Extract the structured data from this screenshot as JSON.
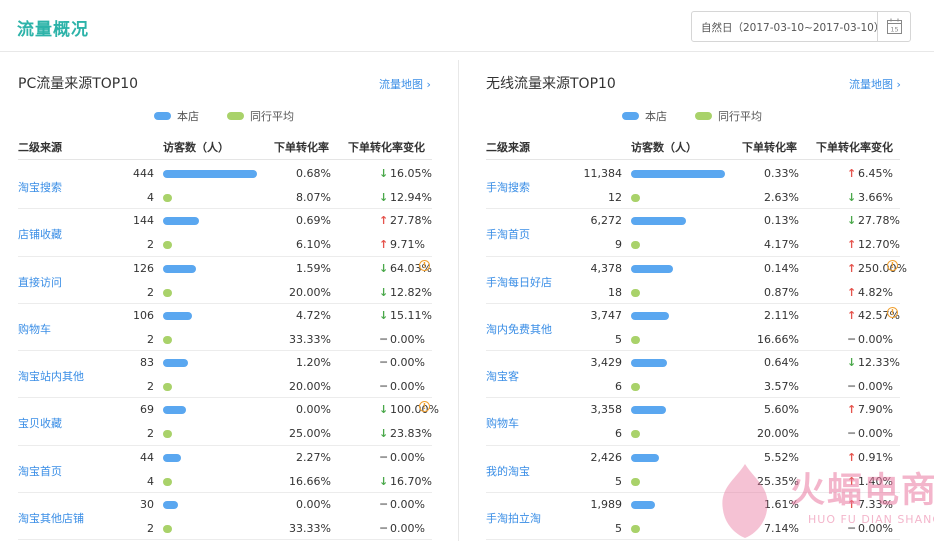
{
  "header": {
    "title": "流量概况",
    "date_range": "自然日（2017-03-10~2017-03-10）",
    "calendar_icon_day": "15"
  },
  "colors": {
    "accent": "#2db3a9",
    "shop_bar": "#5aa7f0",
    "avg_bar": "#a9d26a",
    "up": "#e5544d",
    "down": "#4aa84a",
    "link": "#3a8ee6"
  },
  "legend": {
    "shop": "本店",
    "avg": "同行平均"
  },
  "columns": {
    "source": "二级来源",
    "visitors": "访客数（人）",
    "conversion": "下单转化率",
    "change": "下单转化率变化"
  },
  "pc": {
    "title": "PC流量来源TOP10",
    "map_link": "流量地图 ›",
    "rows": [
      {
        "name": "淘宝搜索",
        "shop": {
          "visitors": "444",
          "conv": "0.68%",
          "dir": "down",
          "chg": "16.05%"
        },
        "avg": {
          "visitors": "4",
          "conv": "8.07%",
          "dir": "down",
          "chg": "12.94%"
        },
        "shop_level": 1.0,
        "avg_level": 0.1,
        "warn": false
      },
      {
        "name": "店铺收藏",
        "shop": {
          "visitors": "144",
          "conv": "0.69%",
          "dir": "up",
          "chg": "27.78%"
        },
        "avg": {
          "visitors": "2",
          "conv": "6.10%",
          "dir": "up",
          "chg": "9.71%"
        },
        "shop_level": 0.38,
        "avg_level": 0.1,
        "warn": false
      },
      {
        "name": "直接访问",
        "shop": {
          "visitors": "126",
          "conv": "1.59%",
          "dir": "down",
          "chg": "64.03%"
        },
        "avg": {
          "visitors": "2",
          "conv": "20.00%",
          "dir": "down",
          "chg": "12.82%"
        },
        "shop_level": 0.35,
        "avg_level": 0.1,
        "warn": true
      },
      {
        "name": "购物车",
        "shop": {
          "visitors": "106",
          "conv": "4.72%",
          "dir": "down",
          "chg": "15.11%"
        },
        "avg": {
          "visitors": "2",
          "conv": "33.33%",
          "dir": "flat",
          "chg": "0.00%"
        },
        "shop_level": 0.31,
        "avg_level": 0.1,
        "warn": false
      },
      {
        "name": "淘宝站内其他",
        "shop": {
          "visitors": "83",
          "conv": "1.20%",
          "dir": "flat",
          "chg": "0.00%"
        },
        "avg": {
          "visitors": "2",
          "conv": "20.00%",
          "dir": "flat",
          "chg": "0.00%"
        },
        "shop_level": 0.27,
        "avg_level": 0.1,
        "warn": false
      },
      {
        "name": "宝贝收藏",
        "shop": {
          "visitors": "69",
          "conv": "0.00%",
          "dir": "down",
          "chg": "100.00%"
        },
        "avg": {
          "visitors": "2",
          "conv": "25.00%",
          "dir": "down",
          "chg": "23.83%"
        },
        "shop_level": 0.24,
        "avg_level": 0.1,
        "warn": true
      },
      {
        "name": "淘宝首页",
        "shop": {
          "visitors": "44",
          "conv": "2.27%",
          "dir": "flat",
          "chg": "0.00%"
        },
        "avg": {
          "visitors": "4",
          "conv": "16.66%",
          "dir": "down",
          "chg": "16.70%"
        },
        "shop_level": 0.19,
        "avg_level": 0.1,
        "warn": false
      },
      {
        "name": "淘宝其他店铺",
        "shop": {
          "visitors": "30",
          "conv": "0.00%",
          "dir": "flat",
          "chg": "0.00%"
        },
        "avg": {
          "visitors": "2",
          "conv": "33.33%",
          "dir": "flat",
          "chg": "0.00%"
        },
        "shop_level": 0.16,
        "avg_level": 0.1,
        "warn": false
      }
    ]
  },
  "mobile": {
    "title": "无线流量来源TOP10",
    "map_link": "流量地图 ›",
    "rows": [
      {
        "name": "手淘搜索",
        "shop": {
          "visitors": "11,384",
          "conv": "0.33%",
          "dir": "up",
          "chg": "6.45%"
        },
        "avg": {
          "visitors": "12",
          "conv": "2.63%",
          "dir": "down",
          "chg": "3.66%"
        },
        "shop_level": 1.0,
        "avg_level": 0.1,
        "warn": false
      },
      {
        "name": "手淘首页",
        "shop": {
          "visitors": "6,272",
          "conv": "0.13%",
          "dir": "down",
          "chg": "27.78%"
        },
        "avg": {
          "visitors": "9",
          "conv": "4.17%",
          "dir": "up",
          "chg": "12.70%"
        },
        "shop_level": 0.59,
        "avg_level": 0.1,
        "warn": false
      },
      {
        "name": "手淘每日好店",
        "shop": {
          "visitors": "4,378",
          "conv": "0.14%",
          "dir": "up",
          "chg": "250.00%"
        },
        "avg": {
          "visitors": "18",
          "conv": "0.87%",
          "dir": "up",
          "chg": "4.82%"
        },
        "shop_level": 0.45,
        "avg_level": 0.1,
        "warn": true
      },
      {
        "name": "淘内免费其他",
        "shop": {
          "visitors": "3,747",
          "conv": "2.11%",
          "dir": "up",
          "chg": "42.57%"
        },
        "avg": {
          "visitors": "5",
          "conv": "16.66%",
          "dir": "flat",
          "chg": "0.00%"
        },
        "shop_level": 0.4,
        "avg_level": 0.1,
        "warn": true
      },
      {
        "name": "淘宝客",
        "shop": {
          "visitors": "3,429",
          "conv": "0.64%",
          "dir": "down",
          "chg": "12.33%"
        },
        "avg": {
          "visitors": "6",
          "conv": "3.57%",
          "dir": "flat",
          "chg": "0.00%"
        },
        "shop_level": 0.38,
        "avg_level": 0.1,
        "warn": false
      },
      {
        "name": "购物车",
        "shop": {
          "visitors": "3,358",
          "conv": "5.60%",
          "dir": "up",
          "chg": "7.90%"
        },
        "avg": {
          "visitors": "6",
          "conv": "20.00%",
          "dir": "flat",
          "chg": "0.00%"
        },
        "shop_level": 0.37,
        "avg_level": 0.1,
        "warn": false
      },
      {
        "name": "我的淘宝",
        "shop": {
          "visitors": "2,426",
          "conv": "5.52%",
          "dir": "up",
          "chg": "0.91%"
        },
        "avg": {
          "visitors": "5",
          "conv": "25.35%",
          "dir": "up",
          "chg": "1.40%"
        },
        "shop_level": 0.3,
        "avg_level": 0.1,
        "warn": false
      },
      {
        "name": "手淘拍立淘",
        "shop": {
          "visitors": "1,989",
          "conv": "1.61%",
          "dir": "up",
          "chg": "7.33%"
        },
        "avg": {
          "visitors": "5",
          "conv": "7.14%",
          "dir": "flat",
          "chg": "0.00%"
        },
        "shop_level": 0.26,
        "avg_level": 0.1,
        "warn": false
      }
    ]
  },
  "watermark": {
    "brand": "火蝠电商",
    "sub": "HUO FU DIAN SHANG"
  }
}
